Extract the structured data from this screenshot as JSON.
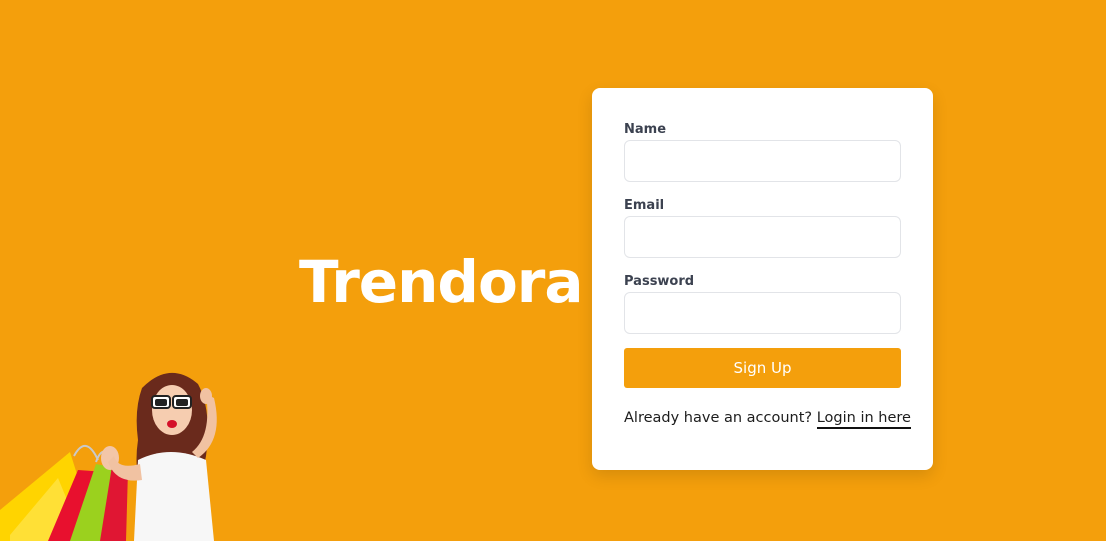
{
  "brand": {
    "name": "Trendora"
  },
  "form": {
    "name_label": "Name",
    "name_value": "",
    "email_label": "Email",
    "email_value": "",
    "password_label": "Password",
    "password_value": "",
    "submit_label": "Sign Up",
    "login_prompt": "Already have an account?",
    "login_link": "Login in here"
  },
  "colors": {
    "background": "#f49f0c",
    "accent": "#f49f0c",
    "card": "#ffffff"
  }
}
